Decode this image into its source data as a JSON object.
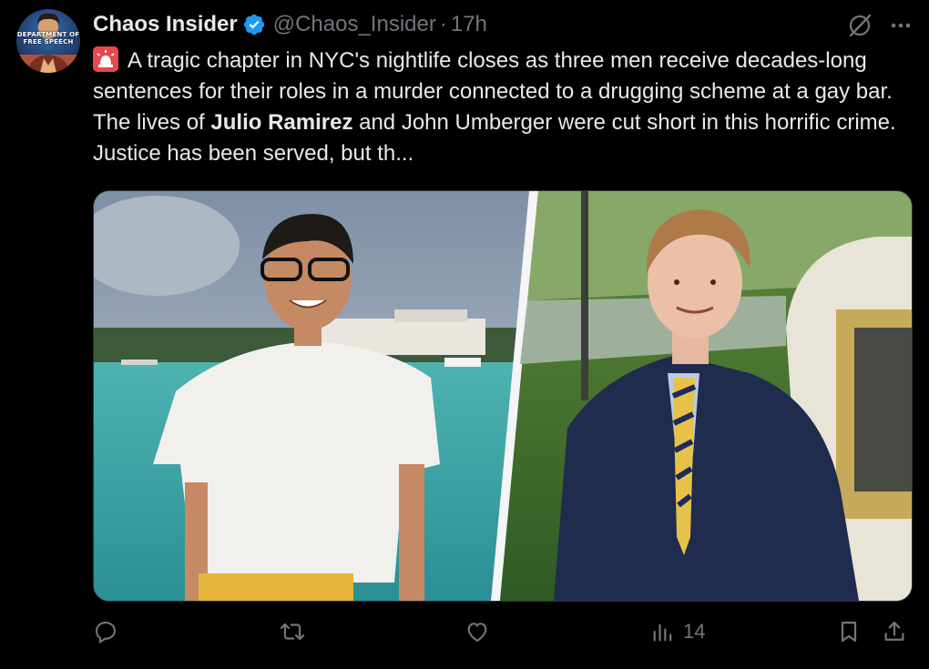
{
  "author": {
    "avatar_text": "DEPARTMENT OF FREE SPEECH",
    "name": "Chaos Insider",
    "handle": "@Chaos_Insider",
    "separator": "·",
    "time": "17h"
  },
  "tweet": {
    "text_part1": "A tragic chapter in NYC's nightlife closes as three men receive decades-long sentences for their roles in a murder connected to a drugging scheme at a gay bar. The lives of ",
    "bold_name": "Julio Ramirez",
    "text_part2": " and John Umberger were cut short in this horrific crime. Justice has been served, but th..."
  },
  "icons": {
    "emoji": "rotating-light-icon",
    "verified": "verified-badge-icon",
    "grok": "grok-icon",
    "more": "more-icon"
  },
  "actions": {
    "reply_count": "",
    "retweet_count": "",
    "like_count": "",
    "views_count": "14"
  },
  "colors": {
    "background": "#000000",
    "text": "#e7e9ea",
    "muted": "#71767b",
    "verified_blue": "#1d9bf0",
    "emoji_red": "#e8474f"
  }
}
